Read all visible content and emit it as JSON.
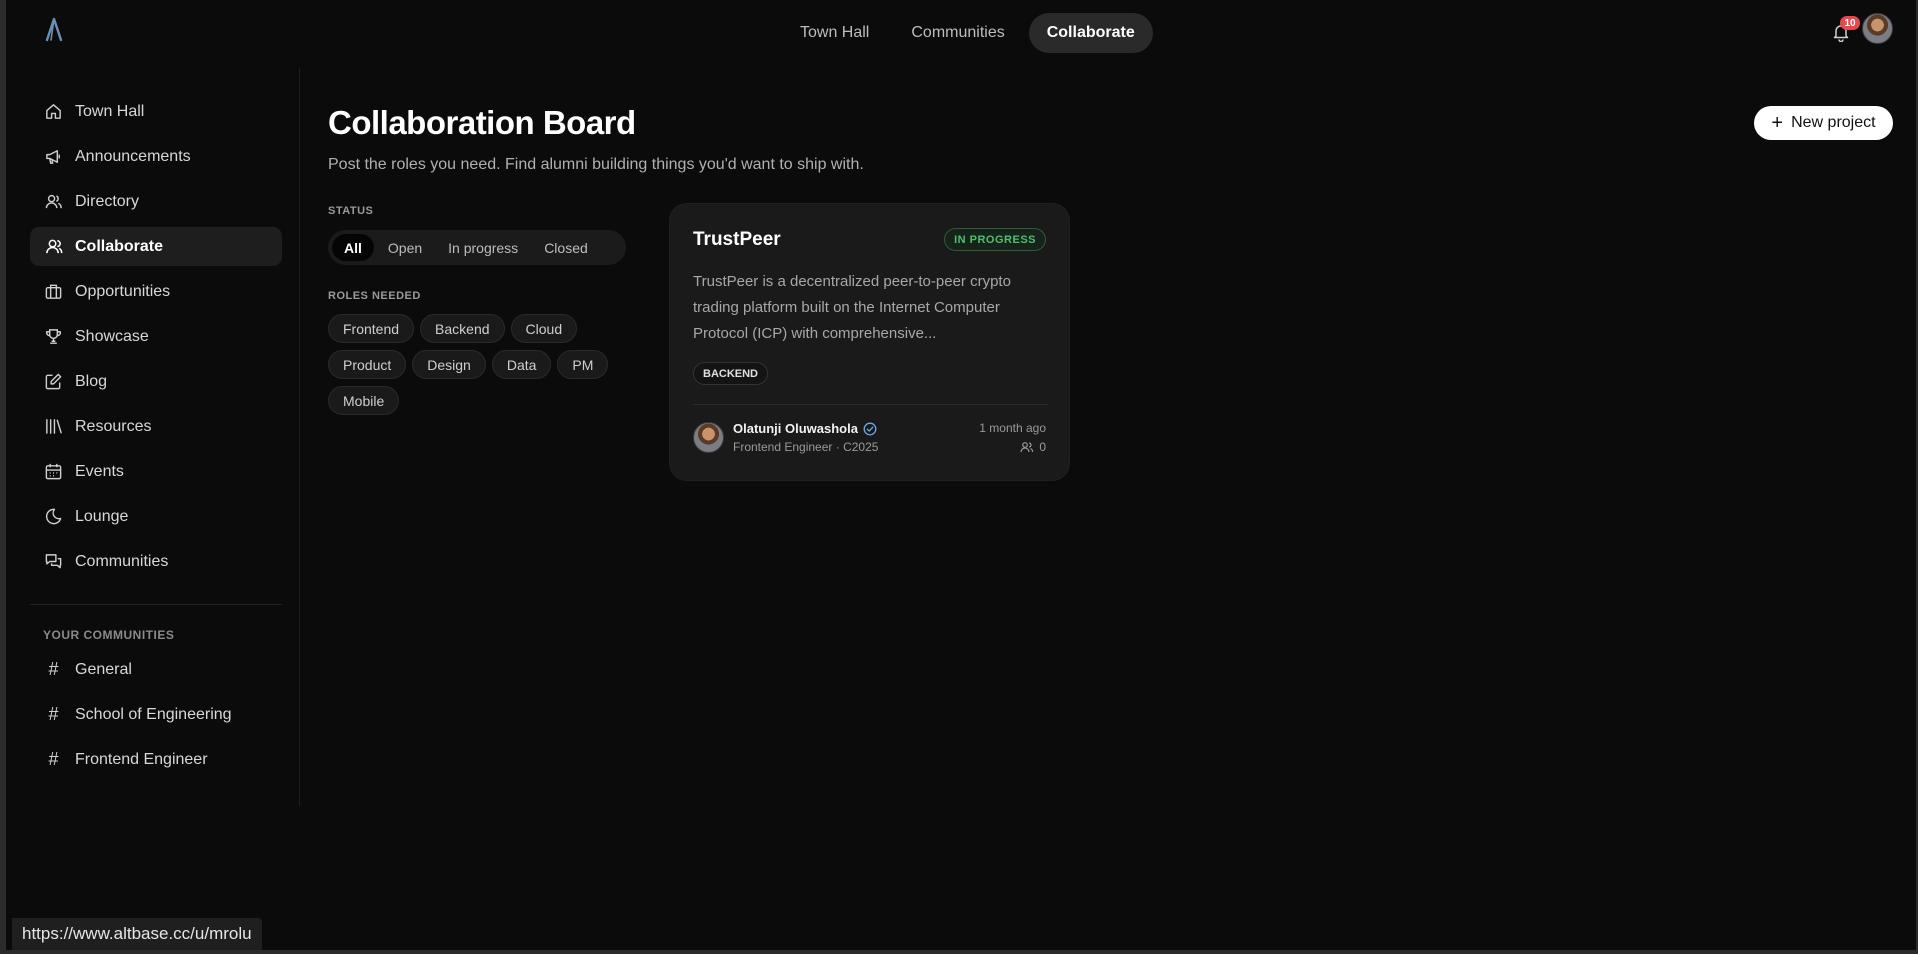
{
  "topnav": {
    "tabs": [
      {
        "label": "Town Hall"
      },
      {
        "label": "Communities"
      },
      {
        "label": "Collaborate"
      }
    ],
    "notification_count": "10"
  },
  "sidebar": {
    "items": [
      {
        "label": "Town Hall",
        "icon": "home-icon"
      },
      {
        "label": "Announcements",
        "icon": "megaphone-icon"
      },
      {
        "label": "Directory",
        "icon": "users-icon"
      },
      {
        "label": "Collaborate",
        "icon": "user-icon"
      },
      {
        "label": "Opportunities",
        "icon": "briefcase-icon"
      },
      {
        "label": "Showcase",
        "icon": "trophy-icon"
      },
      {
        "label": "Blog",
        "icon": "edit-icon"
      },
      {
        "label": "Resources",
        "icon": "library-icon"
      },
      {
        "label": "Events",
        "icon": "calendar-icon"
      },
      {
        "label": "Lounge",
        "icon": "moon-icon"
      },
      {
        "label": "Communities",
        "icon": "chat-icon"
      }
    ],
    "section_title": "YOUR COMMUNITIES",
    "communities": [
      {
        "label": "General"
      },
      {
        "label": "School of Engineering"
      },
      {
        "label": "Frontend Engineer"
      }
    ]
  },
  "main": {
    "title": "Collaboration Board",
    "subtitle": "Post the roles you need. Find alumni building things you'd want to ship with.",
    "new_project_label": "New project",
    "status_label": "STATUS",
    "status_options": [
      "All",
      "Open",
      "In progress",
      "Closed"
    ],
    "roles_label": "ROLES NEEDED",
    "roles": [
      "Frontend",
      "Backend",
      "Cloud",
      "Product",
      "Design",
      "Data",
      "PM",
      "Mobile"
    ]
  },
  "project_card": {
    "title": "TrustPeer",
    "status": "IN PROGRESS",
    "description": "TrustPeer is a decentralized peer-to-peer crypto trading platform built on the Internet Computer Protocol (ICP) with comprehensive...",
    "role_tag": "BACKEND",
    "author_name": "Olatunji Oluwashola",
    "author_meta": "Frontend Engineer · C2025",
    "time": "1 month ago",
    "members": "0"
  },
  "status_url": "https://www.altbase.cc/u/mrolu",
  "colors": {
    "background": "#0b0b0b",
    "card": "#1a1a1a",
    "accent_green": "#4fbf6b",
    "badge_red": "#e5484d",
    "logo_blue": "#6b8fb5"
  }
}
